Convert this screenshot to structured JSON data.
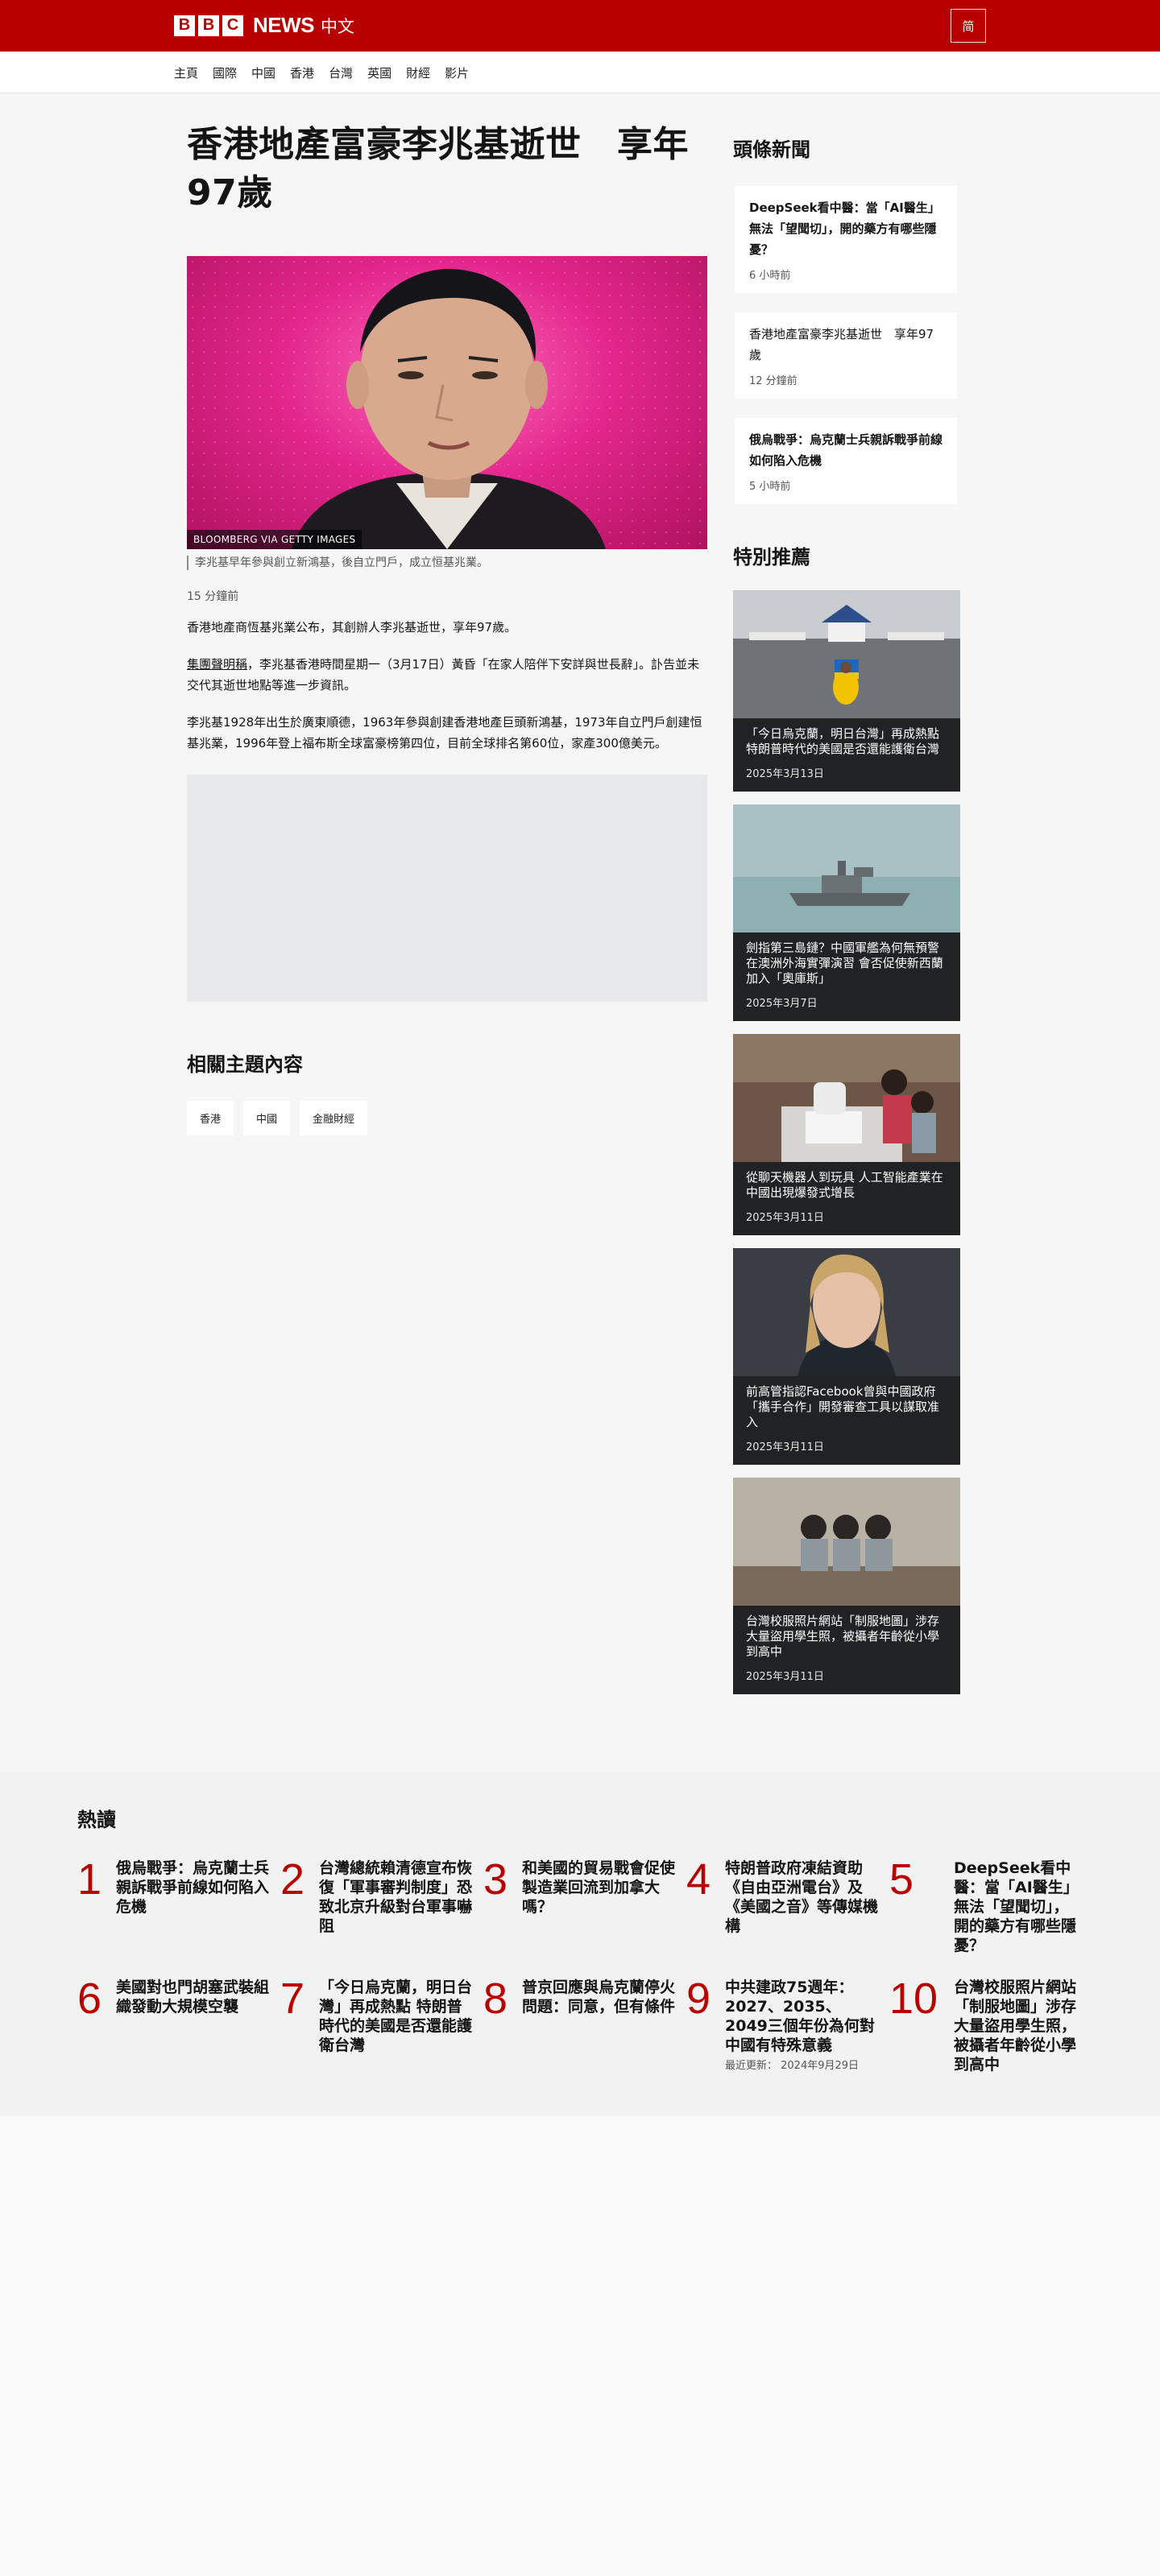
{
  "header": {
    "logo_letters": [
      "B",
      "B",
      "C"
    ],
    "brand": "NEWS",
    "lang": "中文",
    "script_toggle": "简"
  },
  "nav": {
    "items": [
      "主頁",
      "國際",
      "中國",
      "香港",
      "台灣",
      "英國",
      "財經",
      "影片"
    ]
  },
  "article": {
    "headline": "香港地產富豪李兆基逝世　享年97歲",
    "image_credit": "BLOOMBERG VIA GETTY IMAGES",
    "caption": "李兆基早年參與創立新鴻基，後自立門戶，成立恒基兆業。",
    "timestamp": "15 分鐘前",
    "para1": "香港地產商恆基兆業公布，其創辦人李兆基逝世，享年97歲。",
    "para2_link": "集團聲明稱",
    "para2_rest": "，李兆基香港時間星期一（3月17日）黃昏「在家人陪伴下安詳與世長辭」。訃告並未交代其逝世地點等進一步資訊。",
    "para3": "李兆基1928年出生於廣東順德，1963年參與創建香港地產巨頭新鴻基，1973年自立門戶創建恒基兆業，1996年登上福布斯全球富豪榜第四位，目前全球排名第60位，家產300億美元。",
    "related_title": "相關主題內容",
    "tags": [
      "香港",
      "中國",
      "金融財經"
    ]
  },
  "sidebar": {
    "top_title": "頭條新聞",
    "top_stories": [
      {
        "title": "DeepSeek看中醫：當「AI醫生」無法「望聞切」，開的藥方有哪些隱憂？",
        "time": "6 小時前"
      },
      {
        "title": "香港地產富豪李兆基逝世　享年97歲",
        "time": "12 分鐘前"
      },
      {
        "title": "俄烏戰爭：烏克蘭士兵親訴戰爭前線如何陷入危機",
        "time": "5 小時前"
      }
    ],
    "featured_title": "特別推薦",
    "featured": [
      {
        "title": "「今日烏克蘭，明日台灣」再成熱點 特朗普時代的美國是否還能護衛台灣",
        "date": "2025年3月13日"
      },
      {
        "title": "劍指第三島鏈？中國軍艦為何無預警在澳洲外海實彈演習 會否促使新西蘭加入「奧庫斯」",
        "date": "2025年3月7日"
      },
      {
        "title": "從聊天機器人到玩具 人工智能產業在中國出現爆發式增長",
        "date": "2025年3月11日"
      },
      {
        "title": "前高管指認Facebook曾與中國政府「攜手合作」開發審查工具以謀取准入",
        "date": "2025年3月11日"
      },
      {
        "title": "台灣校服照片網站「制服地圖」涉存大量盜用學生照，被攝者年齡從小學到高中",
        "date": "2025年3月11日"
      }
    ]
  },
  "most_read": {
    "title": "熱讀",
    "items": [
      {
        "num": "1",
        "title": "俄烏戰爭：烏克蘭士兵親訴戰爭前線如何陷入危機"
      },
      {
        "num": "2",
        "title": "台灣總統賴清德宣布恢復「軍事審判制度」恐致北京升級對台軍事嚇阻"
      },
      {
        "num": "3",
        "title": "和美國的貿易戰會促使製造業回流到加拿大嗎？"
      },
      {
        "num": "4",
        "title": "特朗普政府凍結資助《自由亞洲電台》及《美國之音》等傳媒機構"
      },
      {
        "num": "5",
        "title": "DeepSeek看中醫：當「AI醫生」無法「望聞切」，開的藥方有哪些隱憂？"
      },
      {
        "num": "6",
        "title": "美國對也門胡塞武裝組織發動大規模空襲"
      },
      {
        "num": "7",
        "title": "「今日烏克蘭，明日台灣」再成熱點 特朗普時代的美國是否還能護衛台灣"
      },
      {
        "num": "8",
        "title": "普京回應與烏克蘭停火問題：同意，但有條件"
      },
      {
        "num": "9",
        "title": "中共建政75週年：2027、2035、2049三個年份為何對中國有特殊意義",
        "sub": "最近更新： 2024年9月29日"
      },
      {
        "num": "10",
        "title": "台灣校服照片網站「制服地圖」涉存大量盜用學生照，被攝者年齡從小學到高中"
      }
    ]
  },
  "colors": {
    "brand_red": "#b80000",
    "card_dark": "#202224",
    "page_bg": "#f6f6f6"
  }
}
